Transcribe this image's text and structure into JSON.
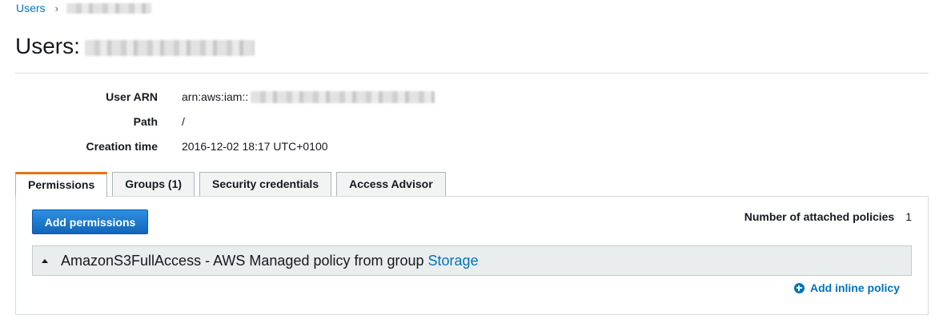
{
  "breadcrumb": {
    "root": "Users",
    "separator": "›"
  },
  "page": {
    "title": "Users:"
  },
  "summary": [
    {
      "label": "User ARN",
      "value": "arn:aws:iam::"
    },
    {
      "label": "Path",
      "value": "/"
    },
    {
      "label": "Creation time",
      "value": "2016-12-02 18:17 UTC+0100"
    }
  ],
  "tabs": [
    {
      "label": "Permissions",
      "active": true
    },
    {
      "label": "Groups (1)",
      "active": false
    },
    {
      "label": "Security credentials",
      "active": false
    },
    {
      "label": "Access Advisor",
      "active": false
    }
  ],
  "permissions": {
    "add_button": "Add permissions",
    "attached_label": "Number of attached policies",
    "attached_count": "1",
    "policy": {
      "text": "AmazonS3FullAccess - AWS Managed policy from group",
      "group_link": "Storage"
    },
    "add_inline": "Add inline policy"
  },
  "colors": {
    "link": "#0073bb",
    "active_tab_accent": "#ec7211",
    "primary_button": "#1166bb"
  }
}
